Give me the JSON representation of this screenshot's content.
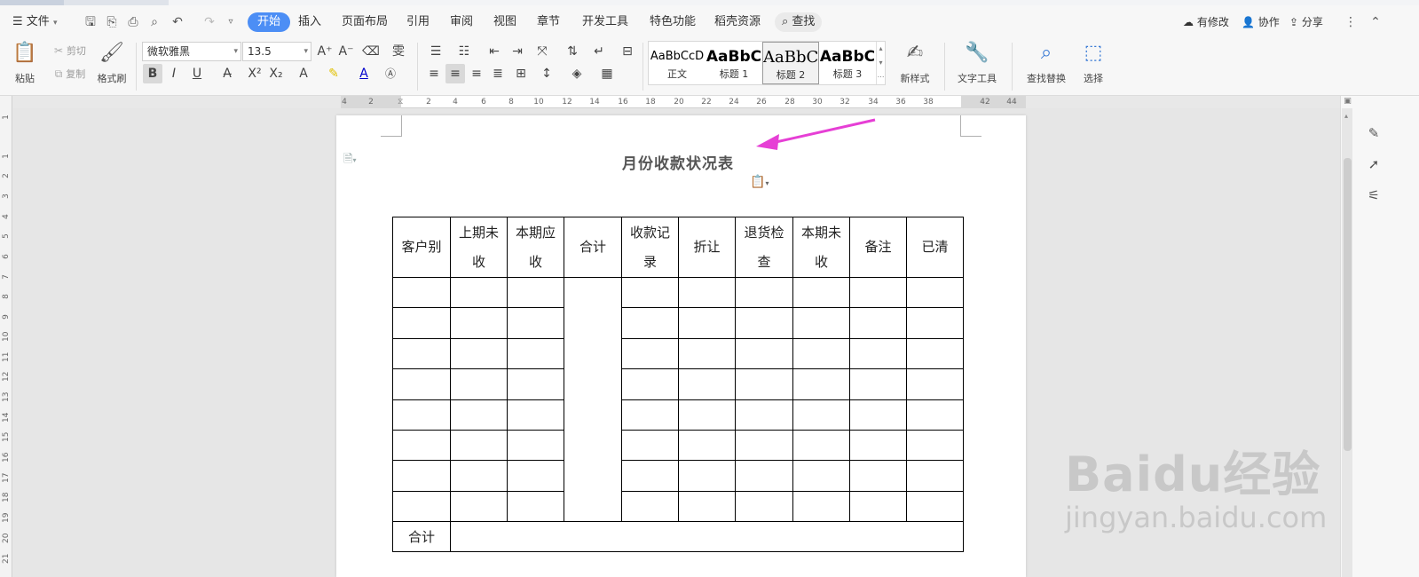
{
  "menubar": {
    "file_label": "文件",
    "tabs": [
      "开始",
      "插入",
      "页面布局",
      "引用",
      "审阅",
      "视图",
      "章节",
      "开发工具",
      "特色功能",
      "稻壳资源"
    ],
    "search_label": "查找",
    "right": {
      "modified": "有修改",
      "collab": "协作",
      "share": "分享"
    }
  },
  "ribbon": {
    "paste": "粘贴",
    "cut": "剪切",
    "copy": "复制",
    "format_painter": "格式刷",
    "font_name": "微软雅黑",
    "font_size": "13.5",
    "styles": [
      {
        "preview": "AaBbCcD",
        "name": "正文"
      },
      {
        "preview": "AaBbC",
        "name": "标题 1"
      },
      {
        "preview": "AaBbC",
        "name": "标题 2"
      },
      {
        "preview": "AaBbC",
        "name": "标题 3"
      }
    ],
    "new_style": "新样式",
    "text_tools": "文字工具",
    "find_replace": "查找替换",
    "select": "选择"
  },
  "ruler": {
    "h_ticks": [
      "4",
      "2",
      "2",
      "4",
      "6",
      "8",
      "10",
      "12",
      "14",
      "16",
      "18",
      "20",
      "22",
      "24",
      "26",
      "28",
      "30",
      "32",
      "34",
      "36",
      "38",
      "42",
      "44"
    ],
    "v_ticks": [
      "1",
      "1",
      "2",
      "3",
      "4",
      "5",
      "6",
      "7",
      "8",
      "9",
      "10",
      "11",
      "12",
      "13",
      "14",
      "15",
      "16",
      "17",
      "18",
      "19",
      "20",
      "21"
    ]
  },
  "document": {
    "title": "月份收款状况表",
    "table": {
      "headers": [
        "客户别",
        "上期未收",
        "本期应收",
        "合计",
        "收款记录",
        "折让",
        "退货检查",
        "本期未收",
        "备注",
        "已清"
      ],
      "empty_rows": 8,
      "footer_label": "合计"
    }
  },
  "watermark": {
    "line1": "Baidu经验",
    "line2": "jingyan.baidu.com"
  },
  "colors": {
    "accent": "#4c8ef5",
    "arrow": "#e63fd5"
  }
}
